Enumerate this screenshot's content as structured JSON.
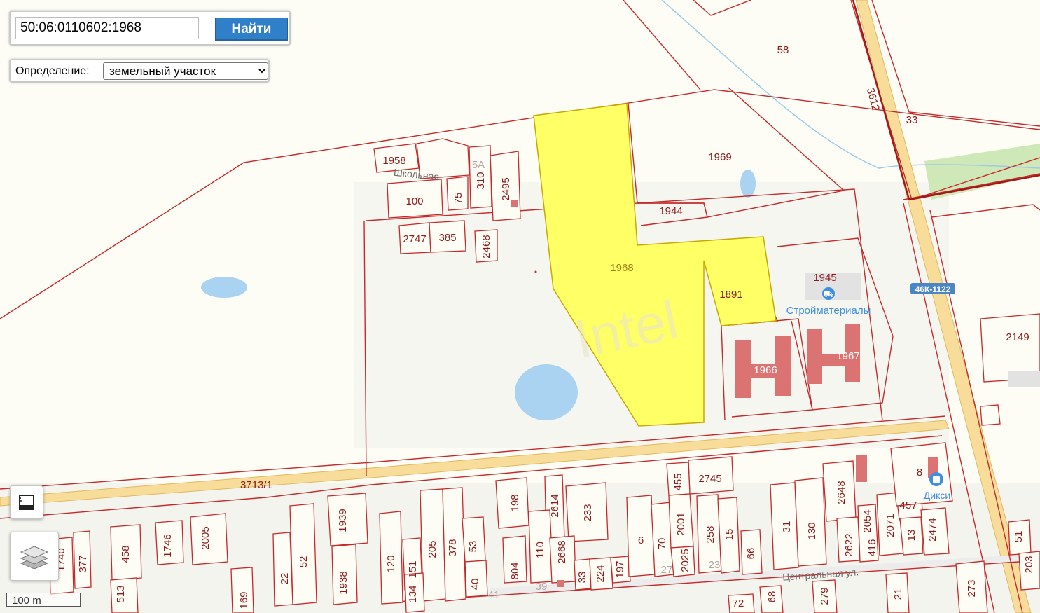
{
  "search": {
    "value": "50:06:0110602:1968",
    "button_label": "Найти"
  },
  "definition": {
    "label": "Определение:",
    "selected": "земельный участок"
  },
  "selected_parcel": {
    "number": "1968",
    "fill": "#ffff66",
    "stroke": "#c8a800"
  },
  "map": {
    "watermark": "Intel",
    "parcel_stroke": "#c52a2a",
    "road_fill": "#f7dc9a",
    "water_fill": "#a9d3f0",
    "parcel_labels": [
      "58",
      "33",
      "3612",
      "1969",
      "1944",
      "1958",
      "100",
      "310",
      "5А",
      "75",
      "2495",
      "2747",
      "385",
      "2468",
      "1945",
      "1891",
      "1966",
      "1967",
      "2149",
      "3713/1",
      "2745",
      "455",
      "198",
      "2614",
      "233",
      "1939",
      "205",
      "378",
      "53",
      "2005",
      "1746",
      "458",
      "1740",
      "377",
      "52",
      "22",
      "1938",
      "169",
      "513",
      "120",
      "151",
      "134",
      "110",
      "2668",
      "804",
      "33",
      "224",
      "197",
      "40",
      "6",
      "70",
      "2001",
      "2025",
      "258",
      "15",
      "66",
      "31",
      "130",
      "2648",
      "2054",
      "2622",
      "416",
      "2071",
      "457",
      "13",
      "2474",
      "8",
      "51",
      "203",
      "273",
      "21",
      "279",
      "72",
      "68",
      "27",
      "23",
      "39",
      "41"
    ],
    "street_labels": [
      "Школьная",
      "Центральная ул."
    ],
    "poi": [
      {
        "name": "Стройматериалы",
        "icon": "cart-icon"
      },
      {
        "name": "Дикси",
        "icon": "shopping-bag-icon"
      }
    ],
    "road_badge": "46К-1122",
    "poi_color": "#3f8fe0"
  },
  "controls": {
    "ruler": {
      "icon": "ruler-icon"
    },
    "layers": {
      "icon": "layers-icon"
    }
  },
  "scale": {
    "label": "100 m"
  }
}
